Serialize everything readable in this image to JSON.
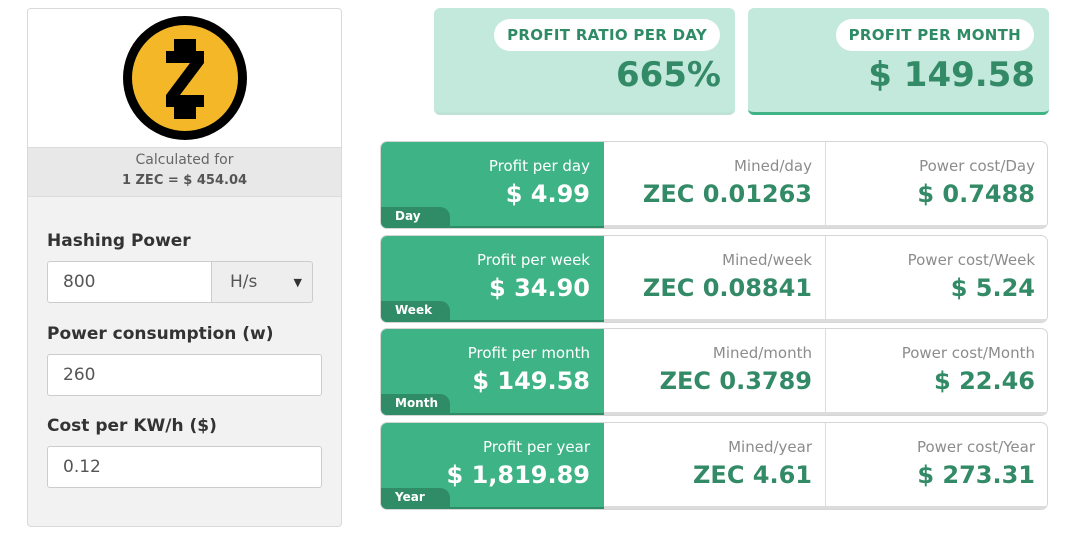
{
  "coin": {
    "logo_icon": "zcash-logo-icon",
    "calculated_for_label": "Calculated for",
    "rate": "1 ZEC = $ 454.04"
  },
  "form": {
    "hashing_power_label": "Hashing Power",
    "hashing_power_value": "800",
    "hashing_unit": "H/s",
    "power_consumption_label": "Power consumption (w)",
    "power_consumption_value": "260",
    "cost_label": "Cost per KW/h ($)",
    "cost_value": "0.12"
  },
  "summary": {
    "profit_ratio_label": "PROFIT RATIO PER DAY",
    "profit_ratio_value": "665%",
    "profit_month_label": "PROFIT PER MONTH",
    "profit_month_value": "$ 149.58"
  },
  "periods": [
    {
      "tag": "Day",
      "profit_label": "Profit per day",
      "profit_value": "$ 4.99",
      "mined_label": "Mined/day",
      "mined_value": "ZEC 0.01263",
      "power_label": "Power cost/Day",
      "power_value": "$ 0.7488"
    },
    {
      "tag": "Week",
      "profit_label": "Profit per week",
      "profit_value": "$ 34.90",
      "mined_label": "Mined/week",
      "mined_value": "ZEC 0.08841",
      "power_label": "Power cost/Week",
      "power_value": "$ 5.24"
    },
    {
      "tag": "Month",
      "profit_label": "Profit per month",
      "profit_value": "$ 149.58",
      "mined_label": "Mined/month",
      "mined_value": "ZEC 0.3789",
      "power_label": "Power cost/Month",
      "power_value": "$ 22.46"
    },
    {
      "tag": "Year",
      "profit_label": "Profit per year",
      "profit_value": "$ 1,819.89",
      "mined_label": "Mined/year",
      "mined_value": "ZEC 4.61",
      "power_label": "Power cost/Year",
      "power_value": "$ 273.31"
    }
  ],
  "colors": {
    "accent_green": "#3eb386",
    "dark_green": "#2f8c67",
    "value_green": "#338a66",
    "summary_bg": "#c3e8dc",
    "zcash_gold": "#f4b728"
  }
}
